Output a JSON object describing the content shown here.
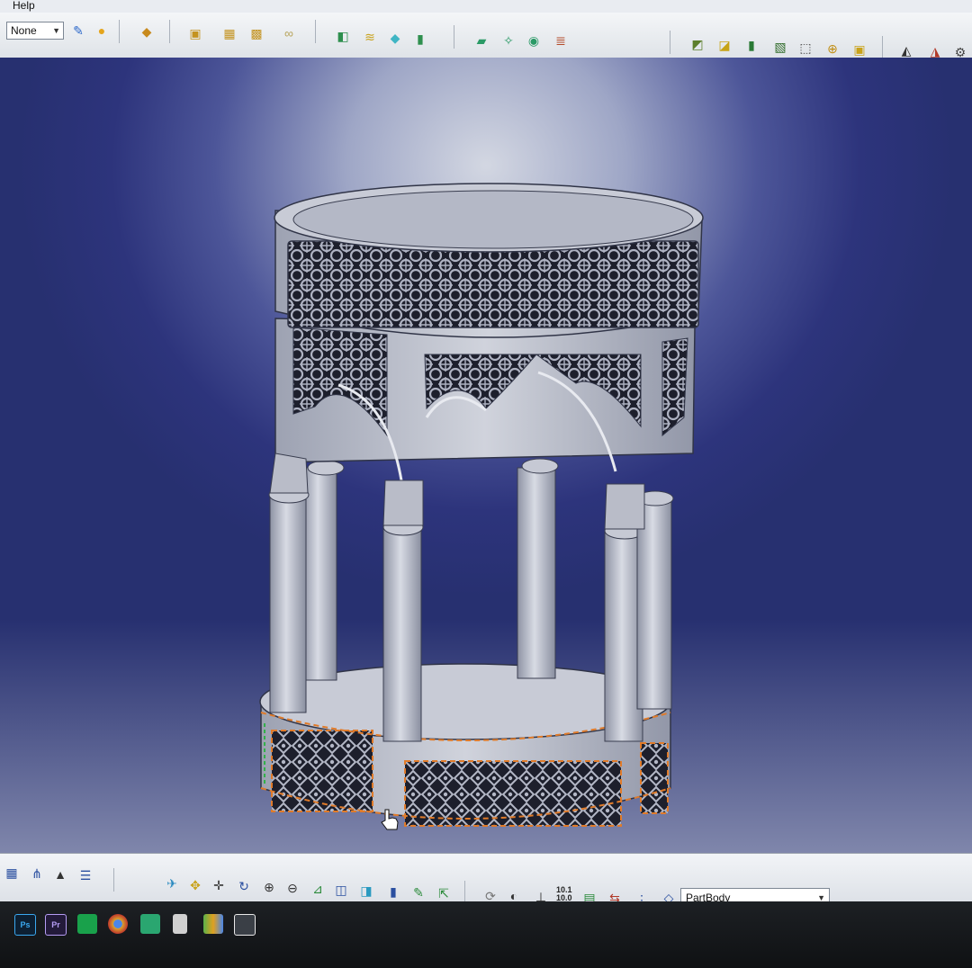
{
  "menu": {
    "help": "Help"
  },
  "toolbar": {
    "layer_select_value": "None",
    "icons": [
      "paint-brush-icon",
      "material-sphere-icon",
      "apply-material-icon",
      "assembly-icon",
      "product-icon",
      "component-icon",
      "link-icon",
      "solid-icon",
      "surface-stack-icon",
      "thin-part-icon",
      "book-icon",
      "sketch-plane-icon",
      "analysis-icon",
      "render-icon",
      "stamp-icon",
      "isometric-view-icon",
      "front-view-icon",
      "shading-icon",
      "wireframe-icon",
      "box-select-icon",
      "target-icon",
      "cube-icon",
      "light-icon",
      "lamp-icon",
      "gear-icon"
    ]
  },
  "bottom_toolbar": {
    "part_body_value": "PartBody",
    "coord_readout": [
      "10.1",
      "10.0"
    ],
    "icons": [
      "table-icon",
      "tree-icon",
      "lock-icon",
      "list-icon",
      "fly-mode-icon",
      "fit-all-icon",
      "pan-icon",
      "rotate-icon",
      "zoom-in-icon",
      "zoom-out-icon",
      "normal-view-icon",
      "multi-view-icon",
      "iso-view-icon",
      "cylinder-icon",
      "edit-icon",
      "export-icon",
      "refresh-icon",
      "globe-icon",
      "axis-icon",
      "coordinate-icon",
      "spool-icon",
      "stack-icon",
      "bullet-list-icon",
      "cube-outline-icon"
    ]
  },
  "taskbar": {
    "apps": [
      {
        "name": "photoshop-icon",
        "label": "Ps",
        "color": "#3aa8f0"
      },
      {
        "name": "premiere-icon",
        "label": "Pr",
        "color": "#b59cf4"
      },
      {
        "name": "green-app-icon",
        "label": "",
        "color": "#19a14b"
      },
      {
        "name": "chrome-icon",
        "label": "",
        "color": "#d9a52f"
      },
      {
        "name": "spreadsheet-icon",
        "label": "",
        "color": "#2aa670"
      },
      {
        "name": "calculator-icon",
        "label": "",
        "color": "#d0d0d0"
      },
      {
        "name": "equalizer-icon",
        "label": "",
        "color": "#5bb24a"
      },
      {
        "name": "catia-icon",
        "label": "",
        "color": "#e8e8e8"
      }
    ]
  },
  "colors": {
    "accent": "#e07b2a",
    "model": "#c3c6d2",
    "viewport_top": "#d3d7e2",
    "viewport_bottom": "#273070"
  }
}
